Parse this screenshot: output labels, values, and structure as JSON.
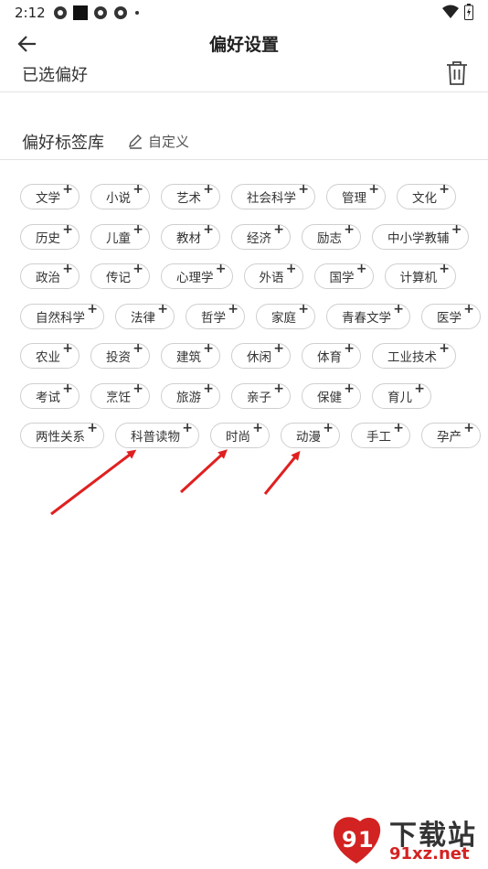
{
  "status_bar": {
    "time": "2:12",
    "icons": [
      "app-icon-1",
      "black-square-icon",
      "app-icon-2",
      "app-icon-3",
      "dot-icon"
    ],
    "right_icons": [
      "wifi-icon",
      "battery-icon"
    ]
  },
  "header": {
    "title": "偏好设置",
    "back_icon": "arrow-left-icon"
  },
  "selected": {
    "label": "已选偏好",
    "delete_icon": "trash-icon"
  },
  "library": {
    "title": "偏好标签库",
    "custom_label": "自定义",
    "custom_icon": "pen-icon"
  },
  "tag_rows": [
    [
      "文学",
      "小说",
      "艺术",
      "社会科学",
      "管理",
      "文化"
    ],
    [
      "历史",
      "儿童",
      "教材",
      "经济",
      "励志",
      "中小学教辅"
    ],
    [
      "政治",
      "传记",
      "心理学",
      "外语",
      "国学",
      "计算机"
    ],
    [
      "自然科学",
      "法律",
      "哲学",
      "家庭",
      "青春文学",
      "医学"
    ],
    [
      "农业",
      "投资",
      "建筑",
      "休闲",
      "体育",
      "工业技术"
    ],
    [
      "考试",
      "烹饪",
      "旅游",
      "亲子",
      "保健",
      "育儿"
    ],
    [
      "两性关系",
      "科普读物",
      "时尚",
      "动漫",
      "手工",
      "孕产"
    ]
  ],
  "tag_plus": "+",
  "colors": {
    "arrow": "#e02020",
    "tag_border": "#cfcfcf",
    "divider": "#e2e2e2",
    "watermark_red": "#d32222"
  },
  "watermark": {
    "line1": "下载站",
    "line2": "91xz.net"
  }
}
